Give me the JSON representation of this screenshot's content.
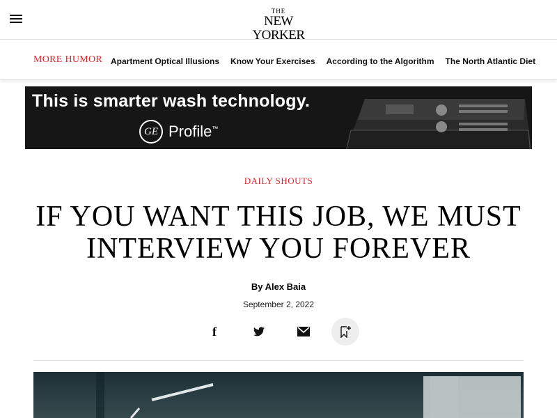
{
  "header": {
    "logo_the": "THE",
    "logo_main": "NEW YORKER"
  },
  "subnav": {
    "title": "MORE HUMOR",
    "links": [
      "Apartment Optical Illusions",
      "Know Your Exercises",
      "According to the Algorithm",
      "The North Atlantic Diet"
    ]
  },
  "ad": {
    "headline": "This is smarter wash technology.",
    "logo_text": "GE",
    "brand": "Profile",
    "brand_tm": "™"
  },
  "article": {
    "rubric": "DAILY SHOUTS",
    "headline": "IF YOU WANT THIS JOB, WE MUST INTERVIEW YOU FOREVER",
    "byline_prefix": "By ",
    "author": "Alex Baia",
    "date": "September 2, 2022"
  },
  "share": {
    "facebook_glyph": "f",
    "icons": [
      "facebook-icon",
      "twitter-icon",
      "email-icon",
      "bookmark-icon"
    ]
  },
  "colors": {
    "accent": "#d9262d",
    "ad_background": "#161616",
    "save_circle": "#eeeeee"
  }
}
